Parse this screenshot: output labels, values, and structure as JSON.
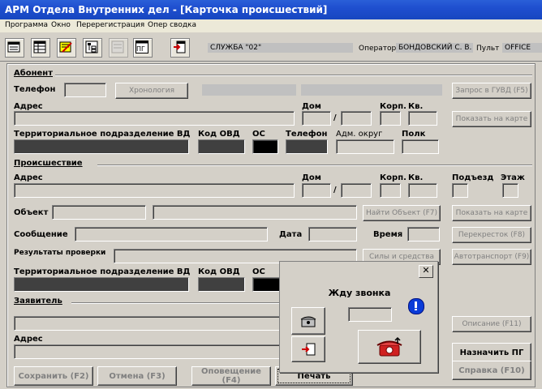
{
  "window": {
    "title": "АРМ Отдела Внутренних дел - [Карточка происшествий]"
  },
  "menu": [
    "Программа",
    "Окно",
    "Перерегистрация",
    "Опер сводка"
  ],
  "toolbar": {
    "pg_label": "ПГ",
    "service": "СЛУЖБА \"02\"",
    "operator_label": "Оператор",
    "operator_value": "БОНДОВСКИЙ С. В.",
    "console_label": "Пульт",
    "console_value": "OFFICE"
  },
  "subscriber": {
    "section": "Абонент",
    "phone_label": "Телефон",
    "chronology_button": "Хронология",
    "request_button": "Запрос в ГУВД (F5)",
    "address_label": "Адрес",
    "house_label": "Дом",
    "slash": "/",
    "building_label": "Корп.",
    "apt_label": "Кв.",
    "map_button": "Показать на карте",
    "terr_label": "Территориальное подразделение ВД",
    "ovd_label": "Код ОВД",
    "os_label": "ОС",
    "phone2_label": "Телефон",
    "district_label": "Адм. округ",
    "regiment_label": "Полк"
  },
  "incident": {
    "section": "Происшествие",
    "address_label": "Адрес",
    "house_label": "Дом",
    "slash": "/",
    "building_label": "Корп.",
    "apt_label": "Кв.",
    "entrance_label": "Подъезд",
    "floor_label": "Этаж",
    "object_label": "Объект",
    "find_object_button": "Найти Объект (F7)",
    "map_button": "Показать на карте",
    "message_label": "Сообщение",
    "date_label": "Дата",
    "time_label": "Время",
    "crossroad_button": "Перекресток (F8)",
    "results_label": "Результаты проверки",
    "forces_button": "Силы и средства",
    "autotransport_button": "Автотранспорт (F9)",
    "terr_label": "Территориальное подразделение ВД",
    "ovd_label": "Код ОВД",
    "os_label": "ОС"
  },
  "applicant": {
    "section": "Заявитель",
    "address_label": "Адрес",
    "description_button": "Описание (F11)",
    "assign_pg_button": "Назначить ПГ",
    "help_button": "Справка (F10)"
  },
  "bottom": {
    "save_button": "Сохранить (F2)",
    "cancel_button": "Отмена (F3)",
    "notify_button": "Оповещение (F4)",
    "print_button": "Печать"
  },
  "dialog": {
    "title": "Жду звонка",
    "close": "✕"
  },
  "colors": {
    "titlebar": "#1f4fcf",
    "dark_field": "#404040"
  }
}
